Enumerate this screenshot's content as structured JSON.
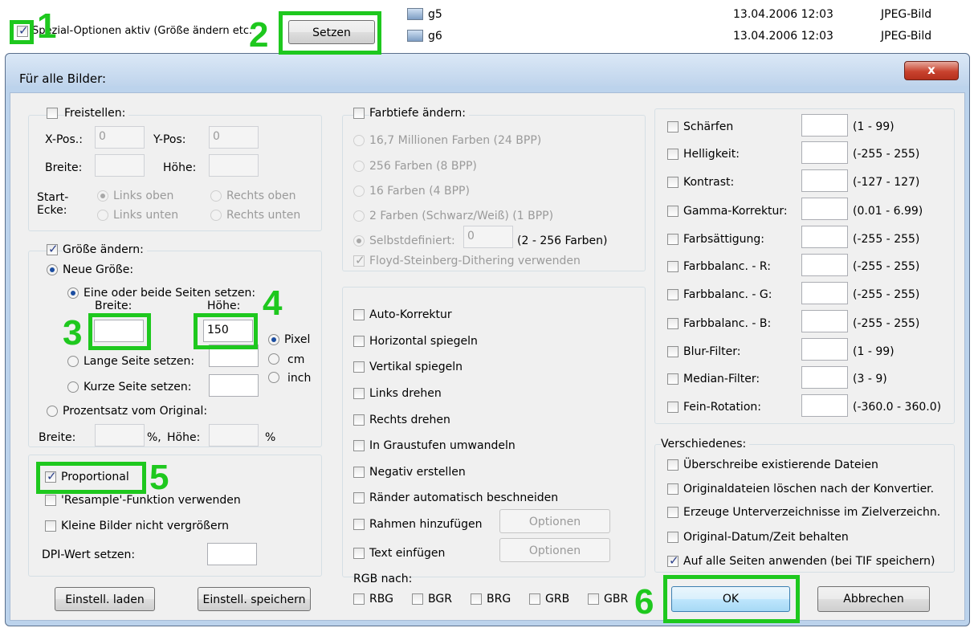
{
  "top_bar": {
    "special_options_label": "Spezial-Optionen aktiv (Größe ändern etc.",
    "setzen_button": "Setzen"
  },
  "files": [
    {
      "name": "g5",
      "date": "13.04.2006 12:03",
      "type": "JPEG-Bild"
    },
    {
      "name": "g6",
      "date": "13.04.2006 12:03",
      "type": "JPEG-Bild"
    }
  ],
  "dialog": {
    "title": "Für alle Bilder:",
    "close_label": "x"
  },
  "crop": {
    "label": "Freistellen:",
    "xpos_label": "X-Pos.:",
    "xpos_value": "0",
    "ypos_label": "Y-Pos:",
    "ypos_value": "0",
    "width_label": "Breite:",
    "height_label": "Höhe:",
    "corner_label_1": "Start-",
    "corner_label_2": "Ecke:",
    "top_left": "Links oben",
    "top_right": "Rechts oben",
    "bottom_left": "Links unten",
    "bottom_right": "Rechts unten"
  },
  "resize": {
    "label": "Größe ändern:",
    "new_size": "Neue Größe:",
    "one_or_both": "Eine oder beide Seiten setzen:",
    "width_label": "Breite:",
    "height_label": "Höhe:",
    "width_value": "",
    "height_value": "150",
    "unit_pixel": "Pixel",
    "unit_cm": "cm",
    "unit_inch": "inch",
    "long_side": "Lange Seite setzen:",
    "short_side": "Kurze Seite setzen:",
    "percent": "Prozentsatz vom Original:",
    "pct_width_label": "Breite:",
    "pct_sym1": "%,",
    "pct_height_label": "Höhe:",
    "pct_sym2": "%"
  },
  "misc_left": {
    "proportional": "Proportional",
    "resample": "'Resample'-Funktion verwenden",
    "no_enlarge": "Kleine Bilder nicht vergrößern",
    "dpi_label": "DPI-Wert setzen:"
  },
  "colordepth": {
    "label": "Farbtiefe ändern:",
    "opt1": "16,7 Millionen Farben (24 BPP)",
    "opt2": "256 Farben (8 BPP)",
    "opt3": "16 Farben (4 BPP)",
    "opt4": "2 Farben (Schwarz/Weiß) (1 BPP)",
    "custom": "Selbstdefiniert:",
    "custom_value": "0",
    "custom_range": "(2 - 256 Farben)",
    "dithering": "Floyd-Steinberg-Dithering verwenden"
  },
  "transforms": {
    "items": [
      "Auto-Korrektur",
      "Horizontal spiegeln",
      "Vertikal spiegeln",
      "Links drehen",
      "Rechts drehen",
      "In Graustufen umwandeln",
      "Negativ erstellen",
      "Ränder automatisch beschneiden",
      "Rahmen hinzufügen",
      "Text einfügen"
    ],
    "options_button": "Optionen",
    "rgb_label": "RGB nach:",
    "rgb_options": [
      "RBG",
      "BGR",
      "BRG",
      "GRB",
      "GBR"
    ]
  },
  "filters": {
    "items": [
      {
        "label": "Schärfen",
        "range": "(1  -  99)"
      },
      {
        "label": "Helligkeit:",
        "range": "(-255  -  255)"
      },
      {
        "label": "Kontrast:",
        "range": "(-127  -  127)"
      },
      {
        "label": "Gamma-Korrektur:",
        "range": "(0.01  -  6.99)"
      },
      {
        "label": "Farbsättigung:",
        "range": "(-255  -  255)"
      },
      {
        "label": "Farbbalanc. - R:",
        "range": "(-255  -  255)"
      },
      {
        "label": "Farbbalanc. - G:",
        "range": "(-255  -  255)"
      },
      {
        "label": "Farbbalanc. - B:",
        "range": "(-255  -  255)"
      },
      {
        "label": "Blur-Filter:",
        "range": "(1  -  99)"
      },
      {
        "label": "Median-Filter:",
        "range": "(3  -  9)"
      },
      {
        "label": "Fein-Rotation:",
        "range": "(-360.0  -  360.0)"
      }
    ]
  },
  "various": {
    "label": "Verschiedenes:",
    "items": [
      "Überschreibe existierende Dateien",
      "Originaldateien löschen nach der Konvertier.",
      "Erzeuge Unterverzeichnisse im Zielverzeichn.",
      "Original-Datum/Zeit behalten",
      "Auf alle Seiten anwenden (bei TIF speichern)"
    ]
  },
  "buttons": {
    "load": "Einstell. laden",
    "save": "Einstell. speichern",
    "ok": "OK",
    "cancel": "Abbrechen"
  },
  "annotations": [
    "1",
    "2",
    "3",
    "4",
    "5",
    "6"
  ],
  "colors": {
    "highlight": "#1ec81e",
    "close_button": "#c9432f"
  }
}
